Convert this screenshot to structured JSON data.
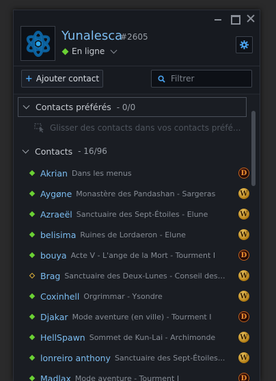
{
  "profile": {
    "username": "Yunalesca",
    "battletag": "#2605",
    "status": "En ligne"
  },
  "toolbar": {
    "add_contact_label": "Ajouter contact",
    "filter_placeholder": "Filtrer"
  },
  "favorites": {
    "title": "Contacts préférés",
    "count": "- 0/0",
    "hint": "Glisser des contacts dans vos contacts préfé..."
  },
  "contacts": {
    "title": "Contacts",
    "count": "- 16/96",
    "items": [
      {
        "name": "Akrian",
        "activity": "Dans les menus",
        "status": "online",
        "game": "Diablo III"
      },
      {
        "name": "Aygøne",
        "activity": "Monastère des Pandashan - Sargeras",
        "status": "online",
        "game": "World of Warcraft"
      },
      {
        "name": "Azraeël",
        "activity": "Sanctuaire des Sept-Étoiles - Elune",
        "status": "online",
        "game": "World of Warcraft"
      },
      {
        "name": "belisima",
        "activity": "Ruines de Lordaeron - Elune",
        "status": "online",
        "game": "World of Warcraft"
      },
      {
        "name": "bouya",
        "activity": "Acte V - L'ange de la Mort - Tourment I",
        "status": "online",
        "game": "Diablo III"
      },
      {
        "name": "Brag",
        "activity": "Sanctuaire des Deux-Lunes - Conseil des ...",
        "status": "away",
        "game": "World of Warcraft"
      },
      {
        "name": "Coxinhell",
        "activity": "Orgrimmar - Ysondre",
        "status": "online",
        "game": "World of Warcraft"
      },
      {
        "name": "Djakar",
        "activity": "Mode aventure (en ville) - Tourment I",
        "status": "online",
        "game": "Diablo III"
      },
      {
        "name": "HellSpawn",
        "activity": "Sommet de Kun-Lai - Archimonde",
        "status": "online",
        "game": "World of Warcraft"
      },
      {
        "name": "lonreiro anthony",
        "activity": "Sanctuaire des Sept-Étoiles...",
        "status": "online",
        "game": "World of Warcraft"
      },
      {
        "name": "Madlax",
        "activity": "Mode aventure - Tourment I",
        "status": "online",
        "game": "Diablo III"
      }
    ]
  },
  "colors": {
    "accent": "#7bbcf0",
    "online": "#6bd134",
    "away": "#e2b43a"
  }
}
